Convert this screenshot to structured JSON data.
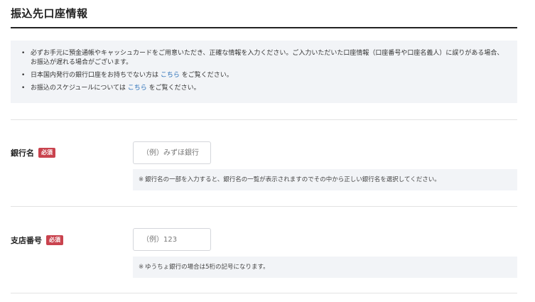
{
  "section": {
    "title": "振込先口座情報"
  },
  "notice": {
    "bullet": "•",
    "items": [
      {
        "text": "必ずお手元に預金通帳やキャッシュカードをご用意いただき、正確な情報を入力ください。ご入力いただいた口座情報（口座番号や口座名義人）に誤りがある場合、お振込が遅れる場合がございます。"
      },
      {
        "before": "日本国内発行の銀行口座をお持ちでない方は ",
        "link": "こちら",
        "after": " をご覧ください。"
      },
      {
        "before": "お振込のスケジュールについては ",
        "link": "こちら",
        "after": " をご覧ください。"
      }
    ]
  },
  "bank_name": {
    "label": "銀行名",
    "required_badge": "必須",
    "value": "",
    "placeholder": "（例）みずほ銀行",
    "hint_mark": "※",
    "hint": "銀行名の一部を入力すると、銀行名の一覧が表示されますのでその中から正しい銀行名を選択してください。"
  },
  "branch_number": {
    "label": "支店番号",
    "required_badge": "必須",
    "value": "",
    "placeholder": "（例）123",
    "hint_mark": "※",
    "hint": "ゆうちょ銀行の場合は5桁の記号になります。"
  },
  "colors": {
    "link": "#2a6fb8",
    "required_badge": "#c9434e",
    "panel_background": "#f2f4f7"
  }
}
